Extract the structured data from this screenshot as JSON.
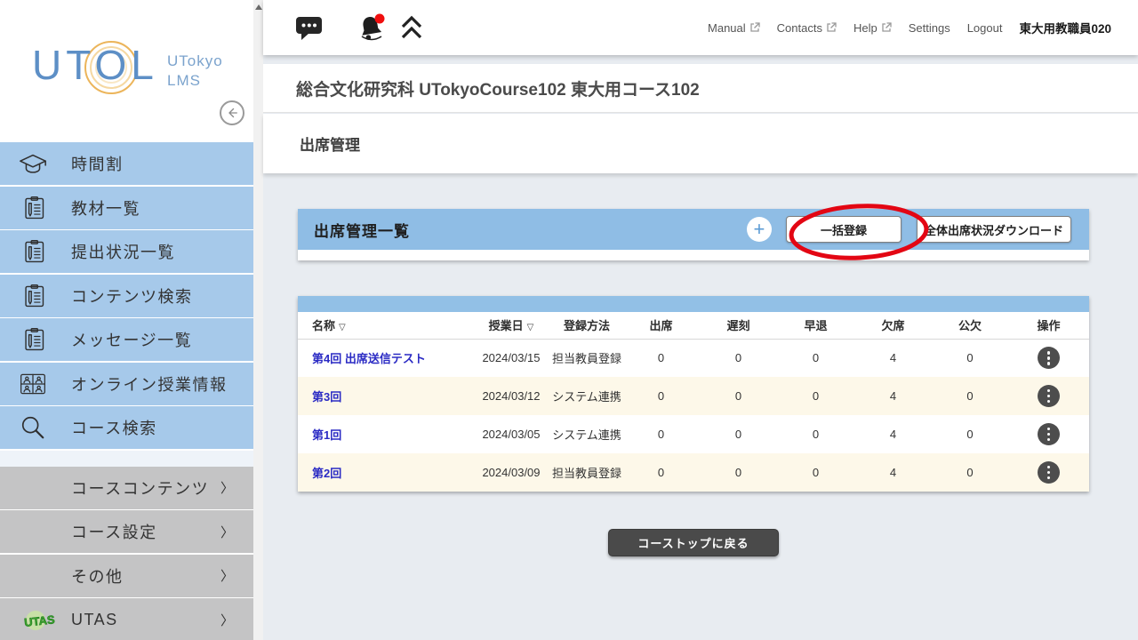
{
  "sidebar": {
    "logo": {
      "title": "UTOL",
      "sub_line1": "UTokyo",
      "sub_line2": "LMS"
    },
    "menu": [
      {
        "label": "時間割",
        "icon": "graduation-cap-icon"
      },
      {
        "label": "教材一覧",
        "icon": "clipboard-icon"
      },
      {
        "label": "提出状況一覧",
        "icon": "clipboard-icon"
      },
      {
        "label": "コンテンツ検索",
        "icon": "clipboard-icon"
      },
      {
        "label": "メッセージ一覧",
        "icon": "clipboard-icon"
      },
      {
        "label": "オンライン授業情報",
        "icon": "online-class-icon"
      },
      {
        "label": "コース検索",
        "icon": "search-icon"
      }
    ],
    "groups": [
      {
        "label": "コースコンテンツ"
      },
      {
        "label": "コース設定"
      },
      {
        "label": "その他"
      },
      {
        "label": "UTAS",
        "icon": "utas-logo"
      }
    ]
  },
  "topbar": {
    "links": [
      {
        "label": "Manual",
        "external": true
      },
      {
        "label": "Contacts",
        "external": true
      },
      {
        "label": "Help",
        "external": true
      },
      {
        "label": "Settings",
        "external": false
      },
      {
        "label": "Logout",
        "external": false
      }
    ],
    "username": "東大用教職員020"
  },
  "page": {
    "course_title": "総合文化研究科 UTokyoCourse102 東大用コース102",
    "section_title": "出席管理"
  },
  "attendance": {
    "panel_title": "出席管理一覧",
    "buttons": {
      "bulk_register": "一括登録",
      "download_all": "全体出席状況ダウンロード",
      "back_to_course_top": "コーストップに戻る"
    },
    "table": {
      "headers": [
        {
          "label": "名称",
          "sort": "▽"
        },
        {
          "label": "授業日",
          "sort": "▽"
        },
        {
          "label": "登録方法"
        },
        {
          "label": "出席"
        },
        {
          "label": "遅刻"
        },
        {
          "label": "早退"
        },
        {
          "label": "欠席"
        },
        {
          "label": "公欠"
        },
        {
          "label": "操作"
        }
      ],
      "rows": [
        {
          "name": "第4回 出席送信テスト",
          "date": "2024/03/15",
          "method": "担当教員登録",
          "present": "0",
          "late": "0",
          "early": "0",
          "absent": "4",
          "excused": "0"
        },
        {
          "name": "第3回",
          "date": "2024/03/12",
          "method": "システム連携",
          "present": "0",
          "late": "0",
          "early": "0",
          "absent": "4",
          "excused": "0"
        },
        {
          "name": "第1回",
          "date": "2024/03/05",
          "method": "システム連携",
          "present": "0",
          "late": "0",
          "early": "0",
          "absent": "4",
          "excused": "0"
        },
        {
          "name": "第2回",
          "date": "2024/03/09",
          "method": "担当教員登録",
          "present": "0",
          "late": "0",
          "early": "0",
          "absent": "4",
          "excused": "0"
        }
      ]
    }
  },
  "icons": {
    "add": "+",
    "chevron_right": "〉"
  },
  "colors": {
    "sidebar_blue": "#a6c9ea",
    "sidebar_gray": "#c4c4c5",
    "panel_blue": "#8fbde5",
    "table_bar_blue": "#92c0e6",
    "row_alt_cream": "#fdf8e9",
    "link_blue": "#2b2bc4",
    "annotation_red": "#e30613",
    "dark_button": "#4a4a4a",
    "notification_red": "#f00e0e"
  }
}
